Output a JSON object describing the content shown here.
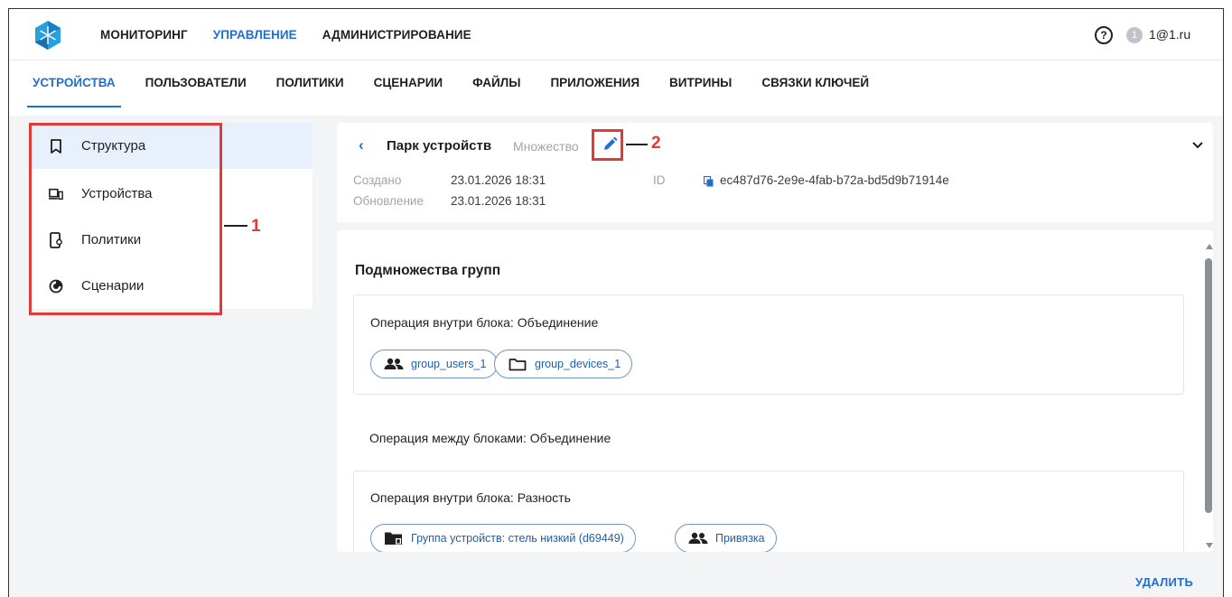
{
  "top_nav": {
    "items": [
      {
        "label": "МОНИТОРИНГ",
        "active": false
      },
      {
        "label": "УПРАВЛЕНИЕ",
        "active": true
      },
      {
        "label": "АДМИНИСТРИРОВАНИЕ",
        "active": false
      }
    ]
  },
  "header_right": {
    "help_icon": "help-circle-icon",
    "badge_count": "1",
    "user_email": "1@1.ru"
  },
  "sub_nav": {
    "tabs": [
      {
        "label": "УСТРОЙСТВА",
        "active": true
      },
      {
        "label": "ПОЛЬЗОВАТЕЛИ",
        "active": false
      },
      {
        "label": "ПОЛИТИКИ",
        "active": false
      },
      {
        "label": "СЦЕНАРИИ",
        "active": false
      },
      {
        "label": "ФАЙЛЫ",
        "active": false
      },
      {
        "label": "ПРИЛОЖЕНИЯ",
        "active": false
      },
      {
        "label": "ВИТРИНЫ",
        "active": false
      },
      {
        "label": "СВЯЗКИ КЛЮЧЕЙ",
        "active": false
      }
    ]
  },
  "sidebar": {
    "items": [
      {
        "label": "Структура",
        "icon": "bookmark-icon",
        "active": true
      },
      {
        "label": "Устройства",
        "icon": "devices-icon",
        "active": false
      },
      {
        "label": "Политики",
        "icon": "policy-phone-icon",
        "active": false
      },
      {
        "label": "Сценарии",
        "icon": "scenario-icon",
        "active": false
      }
    ]
  },
  "callouts": {
    "one": "1",
    "two": "2"
  },
  "detail": {
    "title": "Парк устройств",
    "type": "Множество",
    "created_label": "Создано",
    "created_value": "23.01.2026 18:31",
    "updated_label": "Обновление",
    "updated_value": "23.01.2026 18:31",
    "id_label": "ID",
    "id_value": "ec487d76-2e9e-4fab-b72a-bd5d9b71914e"
  },
  "groups": {
    "section_title": "Подмножества групп",
    "blocks": [
      {
        "title": "Операция внутри блока: Объединение",
        "chips": [
          {
            "label": "group_users_1",
            "icon": "users-icon"
          },
          {
            "label": "group_devices_1",
            "icon": "folder-icon"
          }
        ]
      },
      {
        "title": "Операция внутри блока: Разность",
        "chips": [
          {
            "label": "Группа устройств: стель низкий (d69449)",
            "icon": "device-folder-icon"
          },
          {
            "label": "Привязка",
            "icon": "users-icon"
          }
        ]
      }
    ],
    "between_blocks": "Операция между блоками: Объединение"
  },
  "actions": {
    "delete_label": "УДАЛИТЬ"
  },
  "colors": {
    "accent": "#1f6fd0",
    "callout_red": "#e03a3a",
    "background": "#f3f4f6",
    "logo": "#29a9e0"
  }
}
